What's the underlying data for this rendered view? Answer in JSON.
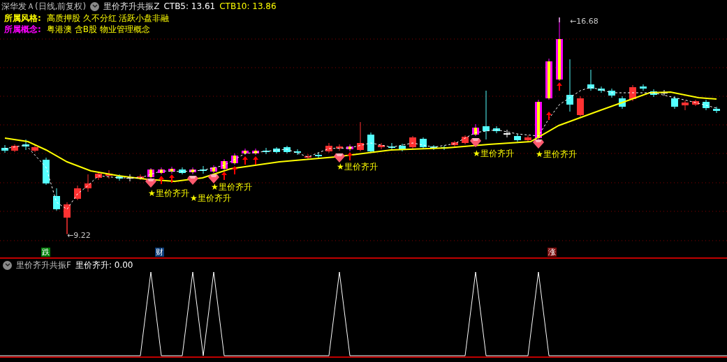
{
  "main_panel": {
    "stock": "深华发Ａ(日线,前复权)",
    "indicator": "里价齐升共振Z",
    "values": [
      {
        "label": "CTB5: 13.61",
        "color": "#ffffff"
      },
      {
        "label": "CTB10: 13.86",
        "color": "#ffff00"
      }
    ],
    "info": [
      {
        "label": "所属风格:",
        "value": "高质押股 久不分红 活跃小盘非融",
        "color": "#ffff00"
      },
      {
        "label": "所属概念:",
        "value": "粤港澳 含B股 物业管理概念",
        "color": "#ff00ff"
      }
    ],
    "price_marks": [
      {
        "text": "←16.68"
      },
      {
        "text": "←9.22"
      }
    ],
    "signals": [
      {
        "text": "★里价齐升"
      },
      {
        "text": "★里价齐升"
      },
      {
        "text": "★里价齐升"
      },
      {
        "text": "★里价齐升"
      },
      {
        "text": "★里价齐升"
      },
      {
        "text": "★里价齐升"
      }
    ],
    "event_badges": [
      {
        "text": "跌",
        "color": "#00800a"
      },
      {
        "text": "财",
        "color": "#0a3c78"
      },
      {
        "text": "涨",
        "color": "#7a0a0a"
      }
    ]
  },
  "sub_panel": {
    "indicator": "里价齐升共振F",
    "reading": "里价齐升: 0.00"
  }
}
